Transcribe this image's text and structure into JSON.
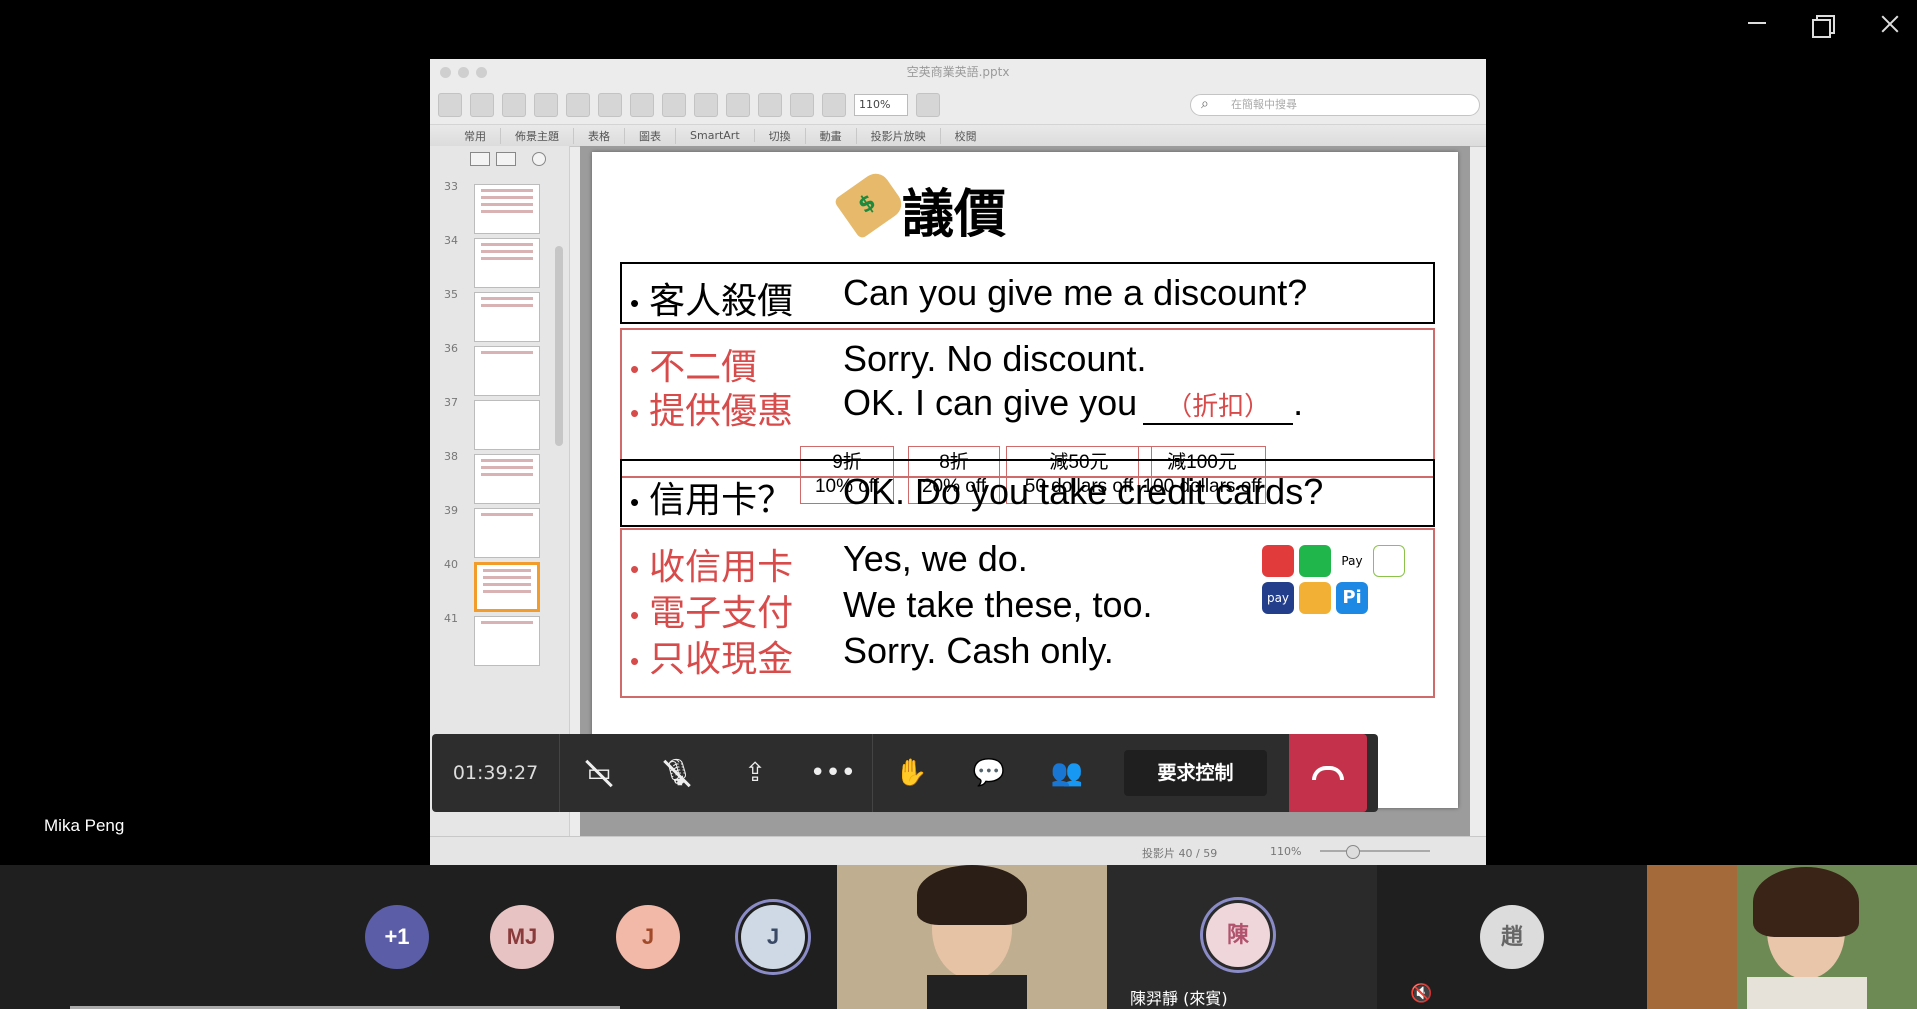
{
  "window": {
    "controls": [
      "minimize",
      "restore",
      "close"
    ]
  },
  "shared_app": {
    "title": "空英商業英語.pptx",
    "zoom": "110%",
    "search_placeholder": "在簡報中搜尋",
    "ribbon_tabs": [
      "常用",
      "佈景主題",
      "表格",
      "圖表",
      "SmartArt",
      "切換",
      "動畫",
      "投影片放映",
      "校閱"
    ],
    "slide_numbers": [
      "33",
      "34",
      "35",
      "36",
      "37",
      "38",
      "39",
      "40",
      "41"
    ],
    "active_slide": "40",
    "status_page": "投影片 40 / 59",
    "status_zoom": "110%"
  },
  "slide": {
    "title": "議價",
    "rows": [
      {
        "zh": "客人殺價",
        "en": "Can you give me a discount?"
      },
      {
        "zh": "不二價",
        "en": "Sorry. No discount."
      },
      {
        "zh": "提供優惠",
        "en": "OK. I can give you",
        "blank": "（折扣）",
        "end": "."
      },
      {
        "zh": "信用卡？",
        "en": "OK. Do you take credit cards?"
      },
      {
        "zh": "收信用卡",
        "en": "Yes, we do."
      },
      {
        "zh": "電子支付",
        "en": "We take these, too."
      },
      {
        "zh": "只收現金",
        "en": "Sorry. Cash only."
      }
    ],
    "discount_options": [
      {
        "zh": "9折",
        "en": "10% off"
      },
      {
        "zh": "8折",
        "en": "20% off"
      },
      {
        "zh": "減50元",
        "en": "50 dollars off"
      },
      {
        "zh": "減100元",
        "en": "100 dollars off"
      }
    ],
    "pay_icons": [
      "jkos-pay-icon",
      "line-pay-icon",
      "apple-pay-icon",
      "google-pay-icon",
      "samsung-pay-icon",
      "pi-wallet-icon",
      "taiwan-pay-icon"
    ],
    "pay_labels": {
      "apple_pay": "Pay",
      "pi": "Pi",
      "samsung": "pay"
    }
  },
  "meeting": {
    "timer": "01:39:27",
    "request_control": "要求控制",
    "presenter_name": "Mika Peng",
    "participants": [
      {
        "initials": "+1",
        "color": "#5b5ea6"
      },
      {
        "initials": "MJ",
        "color": "#e8c3c3"
      },
      {
        "initials": "J",
        "color": "#f2b8a8"
      },
      {
        "initials": "J",
        "color": "#cfd9e5"
      },
      {
        "initials": "陳",
        "color": "#efd6db"
      },
      {
        "initials": "趙",
        "color": "#dcdcdc"
      }
    ],
    "guest_name": "陳羿靜 (來賓)"
  }
}
